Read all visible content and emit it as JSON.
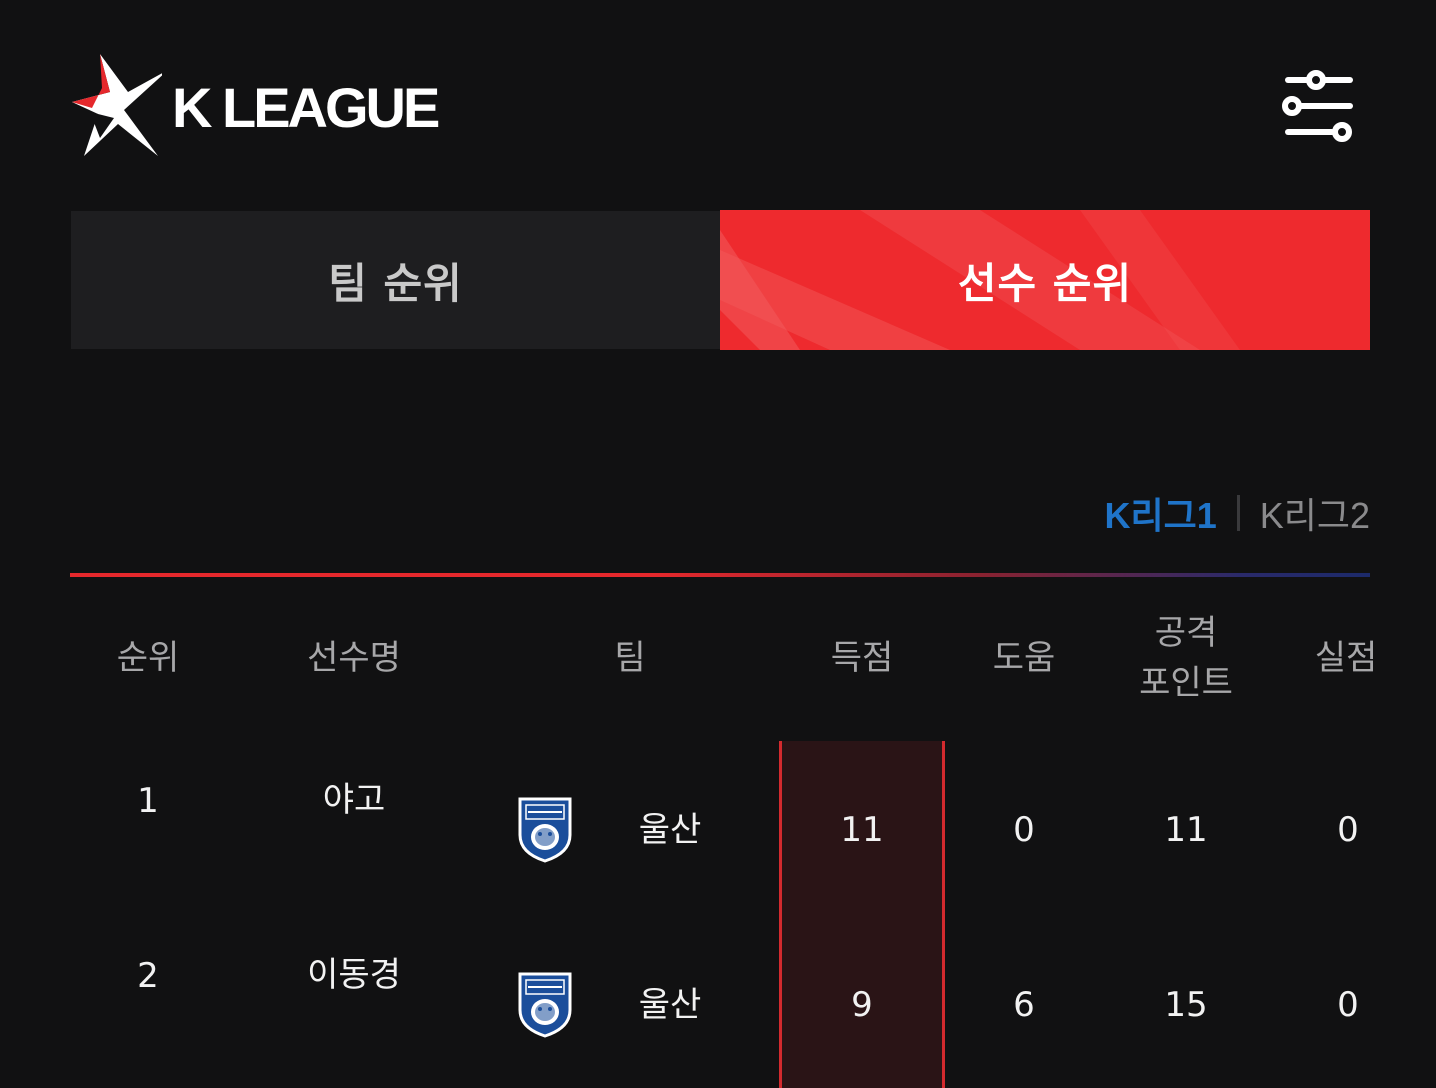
{
  "header": {
    "logo_text": "K LEAGUE",
    "filter_icon": "sliders-icon"
  },
  "tabs": [
    {
      "label": "팀 순위",
      "active": false
    },
    {
      "label": "선수 순위",
      "active": true
    }
  ],
  "league_toggle": {
    "k1_label": "K리그1",
    "k2_label": "K리그2",
    "selected": "K리그1"
  },
  "table": {
    "headers": {
      "rank": "순위",
      "player": "선수명",
      "team": "팀",
      "goals": "득점",
      "assists": "도움",
      "attack_points_line1": "공격",
      "attack_points_line2": "포인트",
      "conceded": "실점"
    },
    "rows": [
      {
        "rank": "1",
        "player": "야고",
        "team_logo": "ulsan-hd-crest",
        "team": "울산",
        "goals": "11",
        "assists": "0",
        "attack_points": "11",
        "conceded": "0"
      },
      {
        "rank": "2",
        "player": "이동경",
        "team_logo": "ulsan-hd-crest",
        "team": "울산",
        "goals": "9",
        "assists": "6",
        "attack_points": "15",
        "conceded": "0"
      }
    ]
  },
  "colors": {
    "background": "#111112",
    "accent_red": "#ee2a2e",
    "k1_blue": "#1f74c9"
  }
}
